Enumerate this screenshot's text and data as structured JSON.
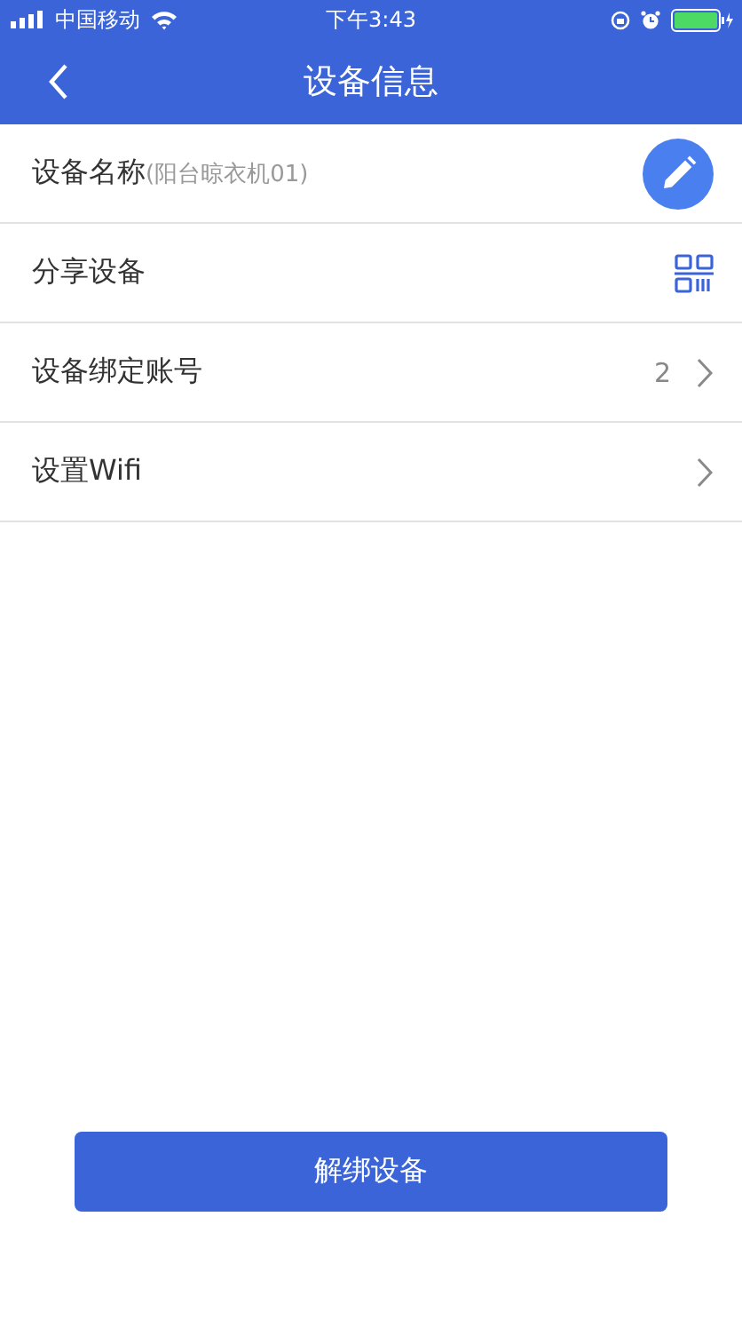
{
  "status_bar": {
    "carrier": "中国移动",
    "time": "下午3:43"
  },
  "nav": {
    "title": "设备信息"
  },
  "rows": [
    {
      "kind": "edit",
      "label": "设备名称",
      "detail": "(阳台晾衣机01)"
    },
    {
      "kind": "qr",
      "label": "分享设备"
    },
    {
      "kind": "link",
      "label": "设备绑定账号",
      "count": "2"
    },
    {
      "kind": "link",
      "label": "设置Wifi"
    }
  ],
  "action_button": "解绑设备"
}
